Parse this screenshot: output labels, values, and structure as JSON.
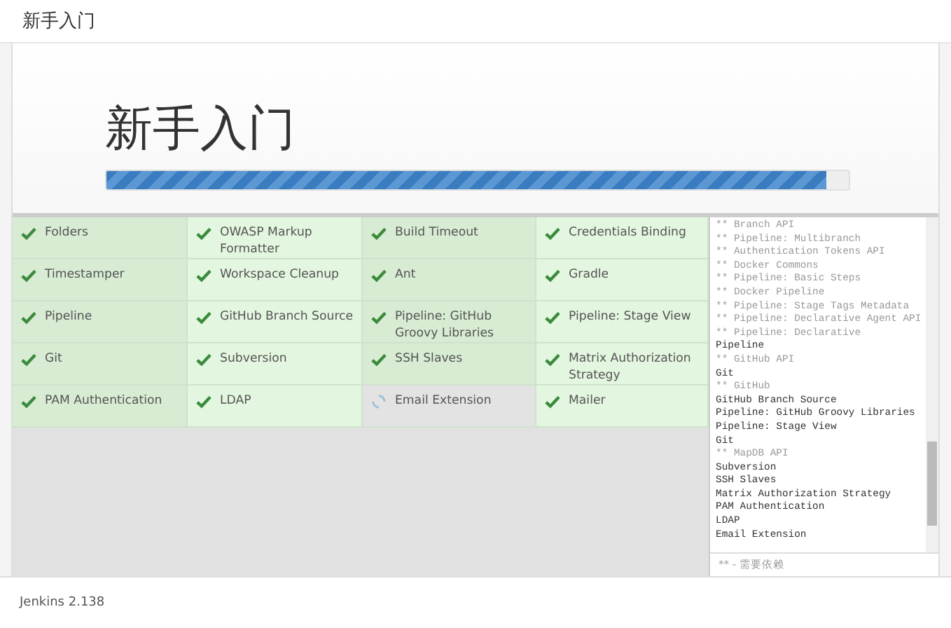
{
  "window": {
    "title": "新手入门"
  },
  "heading": "新手入门",
  "progress": {
    "level": 0.97
  },
  "plugins": [
    {
      "name": "Folders",
      "installed": true
    },
    {
      "name": "OWASP Markup Formatter",
      "installed": true
    },
    {
      "name": "Build Timeout",
      "installed": true
    },
    {
      "name": "Credentials Binding",
      "installed": true
    },
    {
      "name": "Timestamper",
      "installed": true
    },
    {
      "name": "Workspace Cleanup",
      "installed": true
    },
    {
      "name": "Ant",
      "installed": true
    },
    {
      "name": "Gradle",
      "installed": true
    },
    {
      "name": "Pipeline",
      "installed": true
    },
    {
      "name": "GitHub Branch Source",
      "installed": true
    },
    {
      "name": "Pipeline: GitHub Groovy Libraries",
      "installed": true
    },
    {
      "name": "Pipeline: Stage View",
      "installed": true
    },
    {
      "name": "Git",
      "installed": true
    },
    {
      "name": "Subversion",
      "installed": true
    },
    {
      "name": "SSH Slaves",
      "installed": true
    },
    {
      "name": "Matrix Authorization Strategy",
      "installed": true
    },
    {
      "name": "PAM Authentication",
      "installed": true
    },
    {
      "name": "LDAP",
      "installed": true
    },
    {
      "name": "Email Extension",
      "installed": false
    },
    {
      "name": "Mailer",
      "installed": true
    }
  ],
  "log": [
    {
      "text": "** Branch API",
      "kind": "dependency"
    },
    {
      "text": "** Pipeline: Multibranch",
      "kind": "dependency"
    },
    {
      "text": "** Authentication Tokens API",
      "kind": "dependency"
    },
    {
      "text": "** Docker Commons",
      "kind": "dependency"
    },
    {
      "text": "** Pipeline: Basic Steps",
      "kind": "dependency"
    },
    {
      "text": "** Docker Pipeline",
      "kind": "dependency"
    },
    {
      "text": "** Pipeline: Stage Tags Metadata",
      "kind": "dependency"
    },
    {
      "text": "** Pipeline: Declarative Agent API",
      "kind": "dependency"
    },
    {
      "text": "** Pipeline: Declarative",
      "kind": "dependency"
    },
    {
      "text": "Pipeline",
      "kind": "plugin"
    },
    {
      "text": "** GitHub API",
      "kind": "dependency"
    },
    {
      "text": "Git",
      "kind": "plugin"
    },
    {
      "text": "** GitHub",
      "kind": "dependency"
    },
    {
      "text": "GitHub Branch Source",
      "kind": "plugin"
    },
    {
      "text": "Pipeline: GitHub Groovy Libraries",
      "kind": "plugin"
    },
    {
      "text": "Pipeline: Stage View",
      "kind": "plugin"
    },
    {
      "text": "Git",
      "kind": "plugin"
    },
    {
      "text": "** MapDB API",
      "kind": "dependency"
    },
    {
      "text": "Subversion",
      "kind": "plugin"
    },
    {
      "text": "SSH Slaves",
      "kind": "plugin"
    },
    {
      "text": "Matrix Authorization Strategy",
      "kind": "plugin"
    },
    {
      "text": "PAM Authentication",
      "kind": "plugin"
    },
    {
      "text": "LDAP",
      "kind": "plugin"
    },
    {
      "text": "Email Extension",
      "kind": "plugin"
    }
  ],
  "legend": "** - 需要依赖",
  "footer": "Jenkins 2.138"
}
